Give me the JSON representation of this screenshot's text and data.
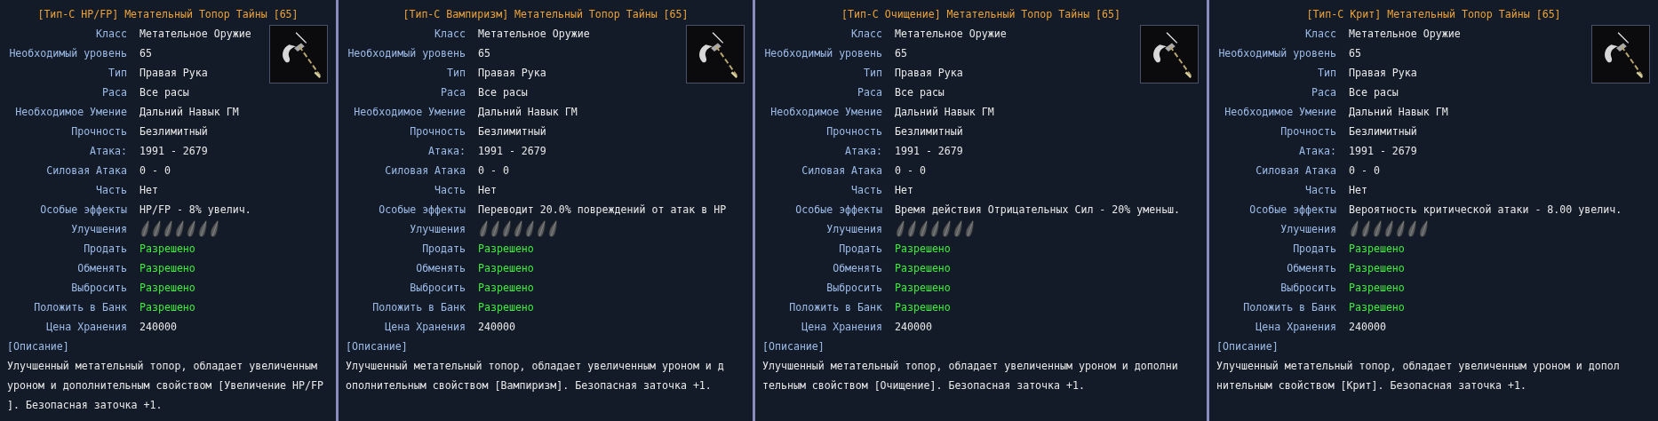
{
  "tooltips": [
    {
      "title": "[Тип-С HP/FP] Метательный Топор Тайны [65]",
      "rows": [
        {
          "kind": "text",
          "label": "Класс",
          "value": "Метательное Оружие"
        },
        {
          "kind": "text",
          "label": "Необходимый уровень",
          "value": "65"
        },
        {
          "kind": "text",
          "label": "Тип",
          "value": "Правая Рука"
        },
        {
          "kind": "text",
          "label": "Раса",
          "value": "Все расы"
        },
        {
          "kind": "text",
          "label": "Необходимое Умение",
          "value": "Дальний Навык ГМ"
        },
        {
          "kind": "text",
          "label": "Прочность",
          "value": "Безлимитный"
        },
        {
          "kind": "text",
          "label": "Атака:",
          "value": "1991 - 2679"
        },
        {
          "kind": "text",
          "label": "Силовая Атака",
          "value": "0 - 0"
        },
        {
          "kind": "text",
          "label": "Часть",
          "value": "Нет"
        },
        {
          "kind": "text",
          "label": "Особые эффекты",
          "value": "HP/FP - 8% увелич."
        },
        {
          "kind": "upgrades",
          "label": "Улучшения",
          "slots": [
            {
              "filled": false
            },
            {
              "filled": false
            },
            {
              "filled": false
            },
            {
              "filled": false
            },
            {
              "filled": false
            },
            {
              "filled": false
            },
            {
              "filled": false
            }
          ]
        },
        {
          "kind": "permission",
          "label": "Продать",
          "value": "Разрешено"
        },
        {
          "kind": "permission",
          "label": "Обменять",
          "value": "Разрешено"
        },
        {
          "kind": "permission",
          "label": "Выбросить",
          "value": "Разрешено"
        },
        {
          "kind": "permission",
          "label": "Положить в Банк",
          "value": "Разрешено"
        },
        {
          "kind": "text",
          "label": "Цена Хранения",
          "value": "240000"
        }
      ],
      "description_heading": "[Описание]",
      "description_lines": [
        "Улучшенный метательный топор, обладает увеличенным",
        "уроном и дополнительным свойством [Увеличение HP/FP",
        "]. Безопасная заточка +1."
      ]
    },
    {
      "title": "[Тип-С Вампиризм] Метательный Топор Тайны [65]",
      "rows": [
        {
          "kind": "text",
          "label": "Класс",
          "value": "Метательное Оружие"
        },
        {
          "kind": "text",
          "label": "Необходимый уровень",
          "value": "65"
        },
        {
          "kind": "text",
          "label": "Тип",
          "value": "Правая Рука"
        },
        {
          "kind": "text",
          "label": "Раса",
          "value": "Все расы"
        },
        {
          "kind": "text",
          "label": "Необходимое Умение",
          "value": "Дальний Навык ГМ"
        },
        {
          "kind": "text",
          "label": "Прочность",
          "value": "Безлимитный"
        },
        {
          "kind": "text",
          "label": "Атака:",
          "value": "1991 - 2679"
        },
        {
          "kind": "text",
          "label": "Силовая Атака",
          "value": "0 - 0"
        },
        {
          "kind": "text",
          "label": "Часть",
          "value": "Нет"
        },
        {
          "kind": "text",
          "label": "Особые эффекты",
          "value": "Переводит 20.0% повреждений от атак в HP"
        },
        {
          "kind": "upgrades",
          "label": "Улучшения",
          "slots": [
            {
              "filled": false
            },
            {
              "filled": false
            },
            {
              "filled": false
            },
            {
              "filled": false
            },
            {
              "filled": false
            },
            {
              "filled": false
            },
            {
              "filled": false
            }
          ]
        },
        {
          "kind": "permission",
          "label": "Продать",
          "value": "Разрешено"
        },
        {
          "kind": "permission",
          "label": "Обменять",
          "value": "Разрешено"
        },
        {
          "kind": "permission",
          "label": "Выбросить",
          "value": "Разрешено"
        },
        {
          "kind": "permission",
          "label": "Положить в Банк",
          "value": "Разрешено"
        },
        {
          "kind": "text",
          "label": "Цена Хранения",
          "value": "240000"
        }
      ],
      "description_heading": "[Описание]",
      "description_lines": [
        "Улучшенный метательный топор, обладает увеличенным уроном и д",
        "ополнительным свойством [Вампиризм]. Безопасная заточка +1."
      ]
    },
    {
      "title": "[Тип-С Очищение] Метательный Топор Тайны [65]",
      "rows": [
        {
          "kind": "text",
          "label": "Класс",
          "value": "Метательное Оружие"
        },
        {
          "kind": "text",
          "label": "Необходимый уровень",
          "value": "65"
        },
        {
          "kind": "text",
          "label": "Тип",
          "value": "Правая Рука"
        },
        {
          "kind": "text",
          "label": "Раса",
          "value": "Все расы"
        },
        {
          "kind": "text",
          "label": "Необходимое Умение",
          "value": "Дальний Навык ГМ"
        },
        {
          "kind": "text",
          "label": "Прочность",
          "value": "Безлимитный"
        },
        {
          "kind": "text",
          "label": "Атака:",
          "value": "1991 - 2679"
        },
        {
          "kind": "text",
          "label": "Силовая Атака",
          "value": "0 - 0"
        },
        {
          "kind": "text",
          "label": "Часть",
          "value": "Нет"
        },
        {
          "kind": "text",
          "label": "Особые эффекты",
          "value": "Время действия Отрицательных Сил - 20% уменьш."
        },
        {
          "kind": "upgrades",
          "label": "Улучшения",
          "slots": [
            {
              "filled": false
            },
            {
              "filled": false
            },
            {
              "filled": false
            },
            {
              "filled": false
            },
            {
              "filled": false
            },
            {
              "filled": false
            },
            {
              "filled": false
            }
          ]
        },
        {
          "kind": "permission",
          "label": "Продать",
          "value": "Разрешено"
        },
        {
          "kind": "permission",
          "label": "Обменять",
          "value": "Разрешено"
        },
        {
          "kind": "permission",
          "label": "Выбросить",
          "value": "Разрешено"
        },
        {
          "kind": "permission",
          "label": "Положить в Банк",
          "value": "Разрешено"
        },
        {
          "kind": "text",
          "label": "Цена Хранения",
          "value": "240000"
        }
      ],
      "description_heading": "[Описание]",
      "description_lines": [
        "Улучшенный метательный топор, обладает увеличенным уроном и дополни",
        "тельным свойством [Очищение]. Безопасная заточка +1."
      ]
    },
    {
      "title": "[Тип-С Крит] Метательный Топор Тайны [65]",
      "rows": [
        {
          "kind": "text",
          "label": "Класс",
          "value": "Метательное Оружие"
        },
        {
          "kind": "text",
          "label": "Необходимый уровень",
          "value": "65"
        },
        {
          "kind": "text",
          "label": "Тип",
          "value": "Правая Рука"
        },
        {
          "kind": "text",
          "label": "Раса",
          "value": "Все расы"
        },
        {
          "kind": "text",
          "label": "Необходимое Умение",
          "value": "Дальний Навык ГМ"
        },
        {
          "kind": "text",
          "label": "Прочность",
          "value": "Безлимитный"
        },
        {
          "kind": "text",
          "label": "Атака:",
          "value": "1991 - 2679"
        },
        {
          "kind": "text",
          "label": "Силовая Атака",
          "value": "0 - 0"
        },
        {
          "kind": "text",
          "label": "Часть",
          "value": "Нет"
        },
        {
          "kind": "text",
          "label": "Особые эффекты",
          "value": "Вероятность критической атаки - 8.00 увелич."
        },
        {
          "kind": "upgrades",
          "label": "Улучшения",
          "slots": [
            {
              "filled": false
            },
            {
              "filled": false
            },
            {
              "filled": false
            },
            {
              "filled": false
            },
            {
              "filled": false
            },
            {
              "filled": false
            },
            {
              "filled": false
            }
          ]
        },
        {
          "kind": "permission",
          "label": "Продать",
          "value": "Разрешено"
        },
        {
          "kind": "permission",
          "label": "Обменять",
          "value": "Разрешено"
        },
        {
          "kind": "permission",
          "label": "Выбросить",
          "value": "Разрешено"
        },
        {
          "kind": "permission",
          "label": "Положить в Банк",
          "value": "Разрешено"
        },
        {
          "kind": "text",
          "label": "Цена Хранения",
          "value": "240000"
        }
      ],
      "description_heading": "[Описание]",
      "description_lines": [
        "Улучшенный метательный топор, обладает увеличенным уроном и допол",
        "нительным свойством [Крит]. Безопасная заточка +1."
      ]
    }
  ]
}
